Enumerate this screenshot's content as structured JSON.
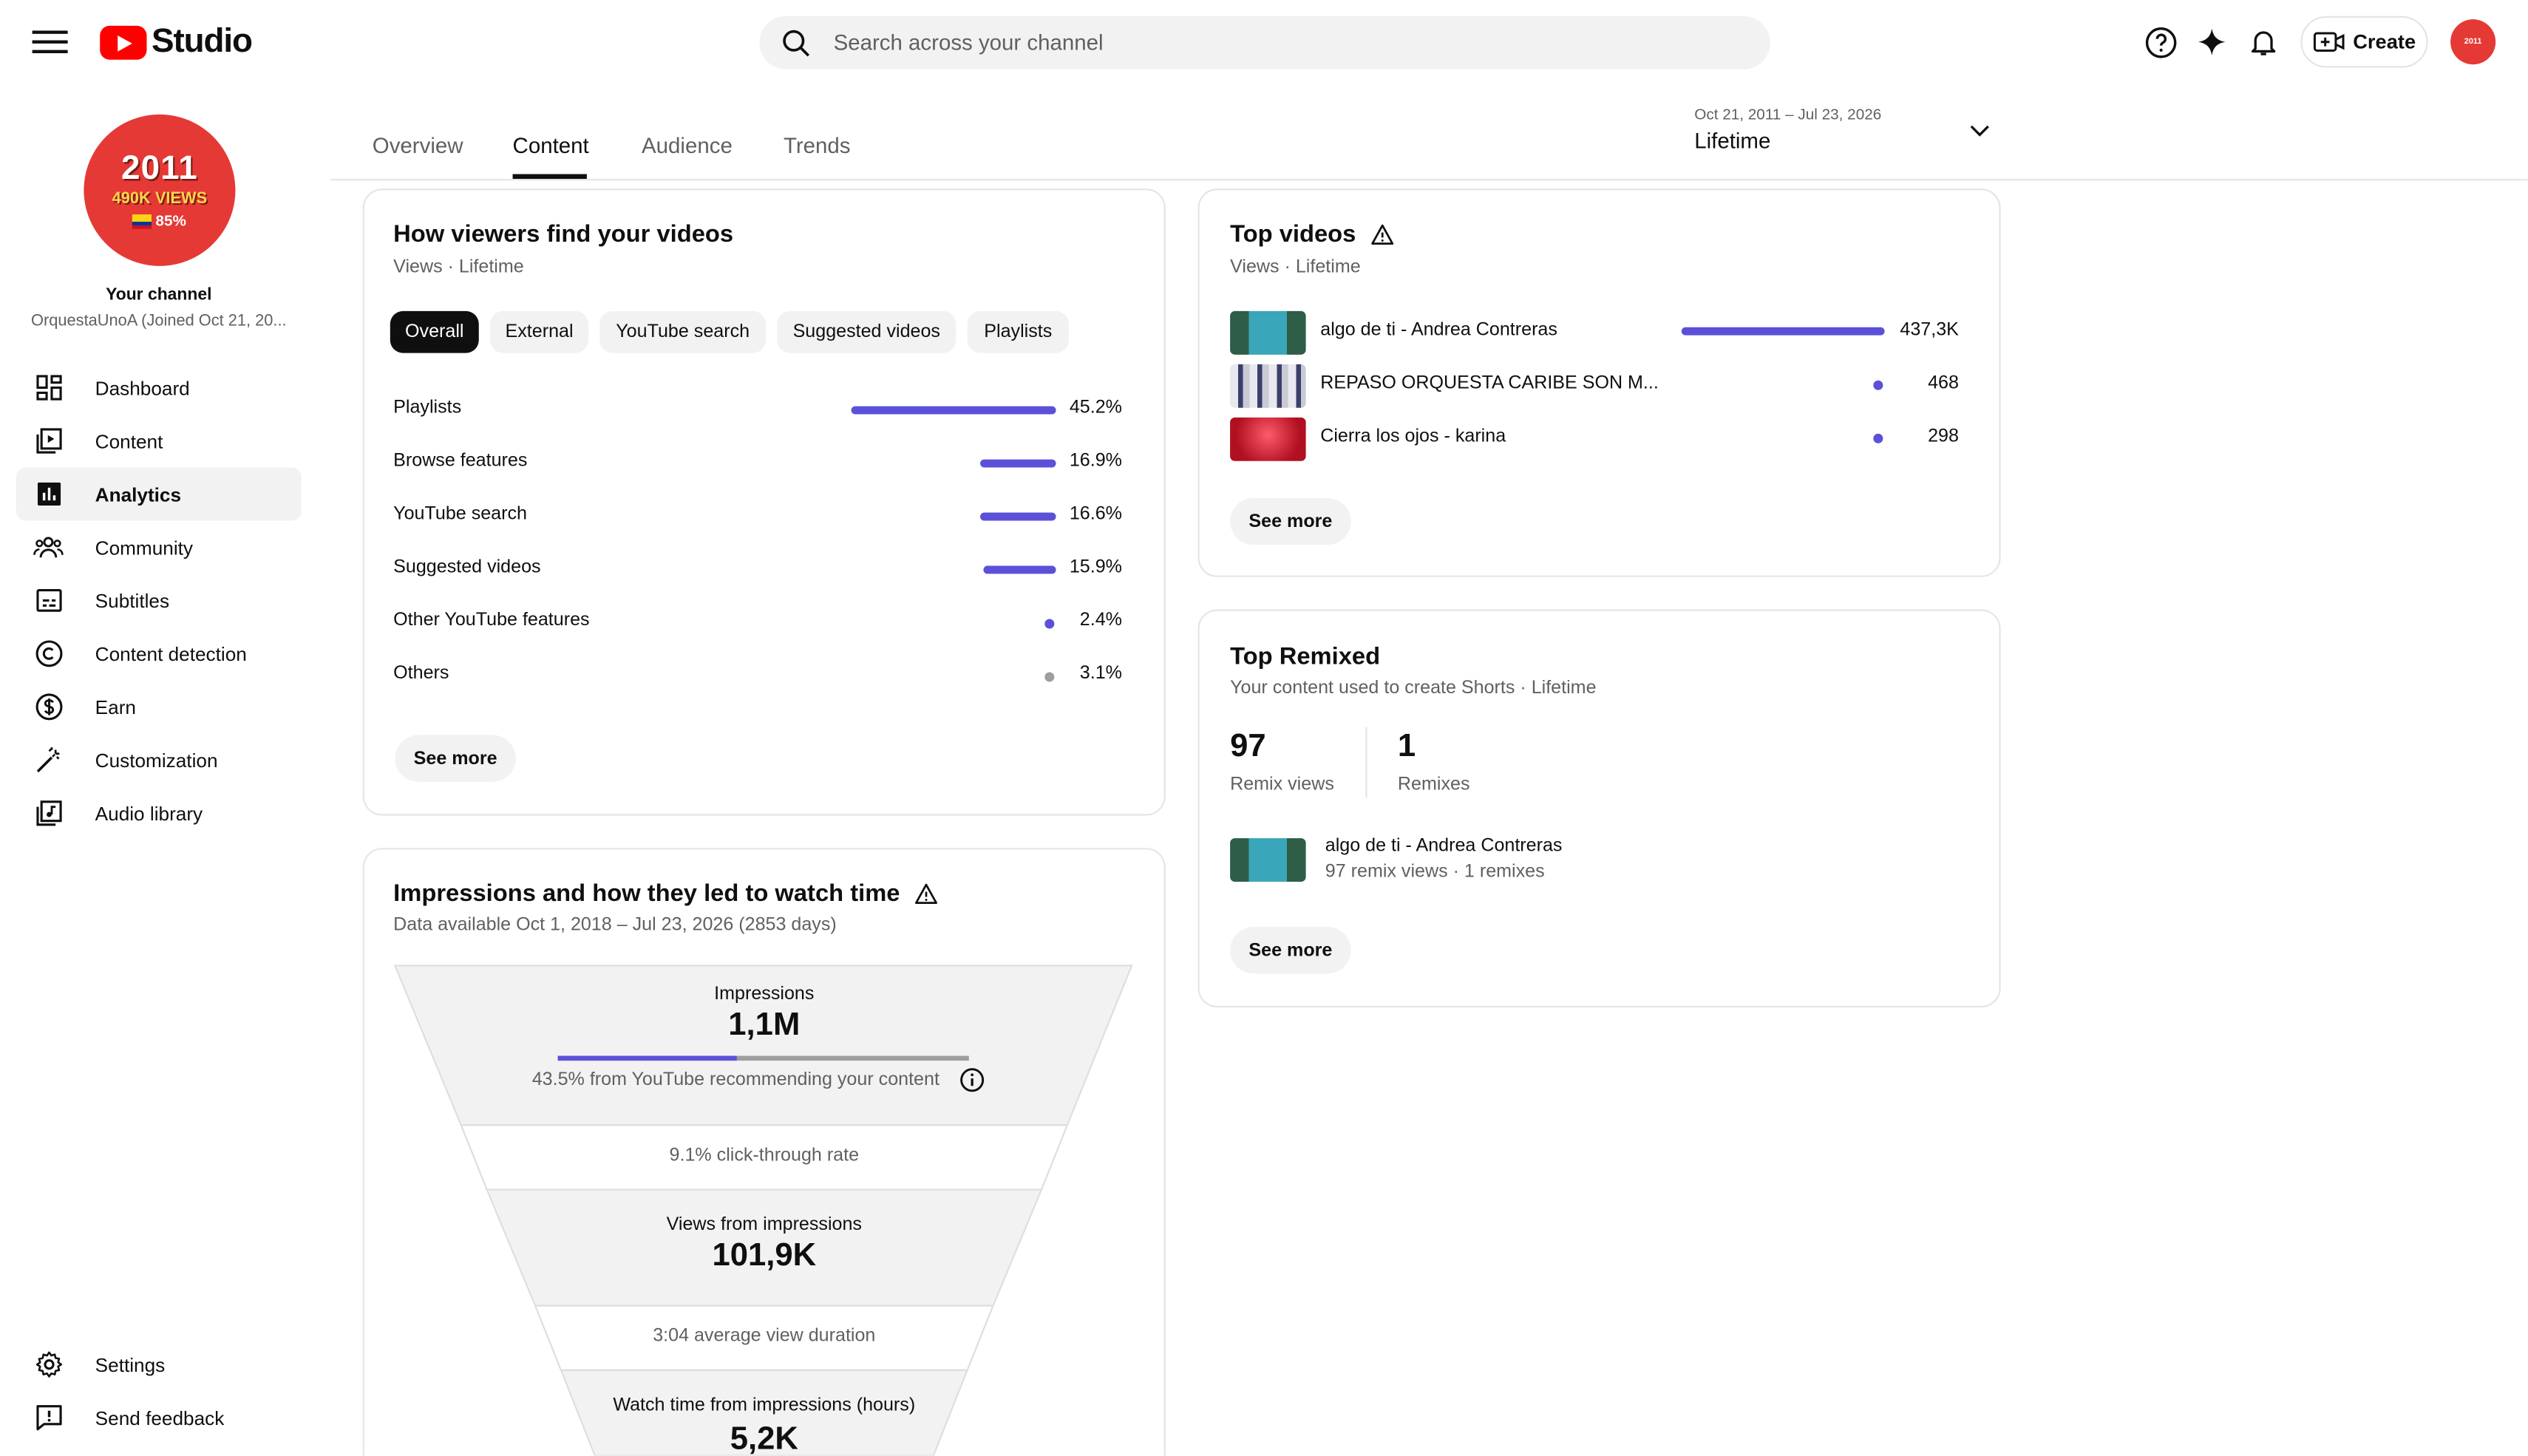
{
  "header": {
    "logo_text": "Studio",
    "search_placeholder": "Search across your channel",
    "create_label": "Create"
  },
  "channel": {
    "avatar_line1": "2011",
    "avatar_line2": "490K VIEWS",
    "avatar_line3": "85%",
    "label": "Your channel",
    "name": "OrquestaUnoA (Joined Oct 21, 20..."
  },
  "sidebar": {
    "items": [
      {
        "label": "Dashboard",
        "icon": "dashboard-icon"
      },
      {
        "label": "Content",
        "icon": "content-icon"
      },
      {
        "label": "Analytics",
        "icon": "analytics-icon",
        "active": true
      },
      {
        "label": "Community",
        "icon": "community-icon"
      },
      {
        "label": "Subtitles",
        "icon": "subtitles-icon"
      },
      {
        "label": "Content detection",
        "icon": "copyright-icon"
      },
      {
        "label": "Earn",
        "icon": "dollar-icon"
      },
      {
        "label": "Customization",
        "icon": "magic-wand-icon"
      },
      {
        "label": "Audio library",
        "icon": "audio-library-icon"
      }
    ],
    "bottom": [
      {
        "label": "Settings",
        "icon": "gear-icon"
      },
      {
        "label": "Send feedback",
        "icon": "feedback-icon"
      }
    ]
  },
  "tabs": [
    "Overview",
    "Content",
    "Audience",
    "Trends"
  ],
  "active_tab": "Content",
  "date": {
    "range": "Oct 21, 2011 – Jul 23, 2026",
    "value": "Lifetime"
  },
  "traffic_sources": {
    "title": "How viewers find your videos",
    "subtitle": "Views · Lifetime",
    "chips": [
      "Overall",
      "External",
      "YouTube search",
      "Suggested videos",
      "Playlists"
    ],
    "active_chip": "Overall",
    "rows": [
      {
        "label": "Playlists",
        "pct": "45.2%",
        "value": 45.2
      },
      {
        "label": "Browse features",
        "pct": "16.9%",
        "value": 16.9
      },
      {
        "label": "YouTube search",
        "pct": "16.6%",
        "value": 16.6
      },
      {
        "label": "Suggested videos",
        "pct": "15.9%",
        "value": 15.9
      },
      {
        "label": "Other YouTube features",
        "pct": "2.4%",
        "value": 2.4
      },
      {
        "label": "Others",
        "pct": "3.1%",
        "value": 3.1
      }
    ],
    "see_more": "See more"
  },
  "top_videos": {
    "title": "Top videos",
    "subtitle": "Views · Lifetime",
    "rows": [
      {
        "title": "algo de ti - Andrea Contreras",
        "views": "437,3K",
        "value": 437300
      },
      {
        "title": "REPASO ORQUESTA CARIBE SON M...",
        "views": "468",
        "value": 468
      },
      {
        "title": "Cierra los ojos - karina",
        "views": "298",
        "value": 298
      }
    ],
    "see_more": "See more"
  },
  "top_remixed": {
    "title": "Top Remixed",
    "subtitle": "Your content used to create Shorts · Lifetime",
    "remix_views": "97",
    "remix_views_label": "Remix views",
    "remixes": "1",
    "remixes_label": "Remixes",
    "item_title": "algo de ti - Andrea Contreras",
    "item_meta": "97 remix views · 1 remixes",
    "see_more": "See more"
  },
  "impressions": {
    "title": "Impressions and how they led to watch time",
    "subtitle": "Data available Oct 1, 2018 – Jul 23, 2026 (2853 days)",
    "impressions_label": "Impressions",
    "impressions_value": "1,1M",
    "recommend_text": "43.5% from YouTube recommending your content",
    "recommend_fraction": 0.435,
    "ctr_text": "9.1% click-through rate",
    "views_label": "Views from impressions",
    "views_value": "101,9K",
    "avd_text": "3:04 average view duration",
    "watch_label": "Watch time from impressions (hours)",
    "watch_value": "5,2K"
  },
  "colors": {
    "accent": "#5b51d8",
    "brand": "#ff0000",
    "avatar": "#e53935"
  }
}
